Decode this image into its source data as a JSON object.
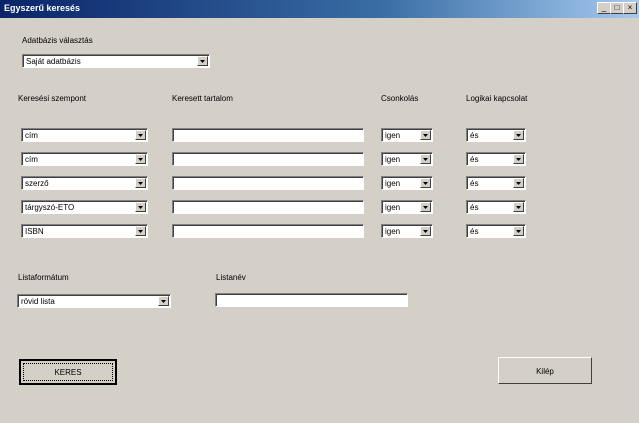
{
  "window": {
    "title": "Egyszerű keresés",
    "minimize_glyph": "_",
    "maximize_glyph": "□",
    "close_glyph": "×"
  },
  "database": {
    "label": "Adatbázis választás",
    "selected": "Saját adatbázis"
  },
  "headers": {
    "criterion": "Keresési szempont",
    "content": "Keresett tartalom",
    "truncation": "Csonkolás",
    "logic": "Logikai kapcsolat"
  },
  "rows": [
    {
      "criterion": "cím",
      "content": "",
      "truncation": "igen",
      "logic": "és"
    },
    {
      "criterion": "cím",
      "content": "",
      "truncation": "igen",
      "logic": "és"
    },
    {
      "criterion": "szerző",
      "content": "",
      "truncation": "igen",
      "logic": "és"
    },
    {
      "criterion": "tárgyszó-ETO",
      "content": "",
      "truncation": "igen",
      "logic": "és"
    },
    {
      "criterion": "ISBN",
      "content": "",
      "truncation": "igen",
      "logic": "és"
    }
  ],
  "list_format": {
    "label": "Listaformátum",
    "selected": "rövid lista"
  },
  "list_name": {
    "label": "Listanév",
    "value": ""
  },
  "buttons": {
    "search": "KERES",
    "exit": "Kilép"
  }
}
